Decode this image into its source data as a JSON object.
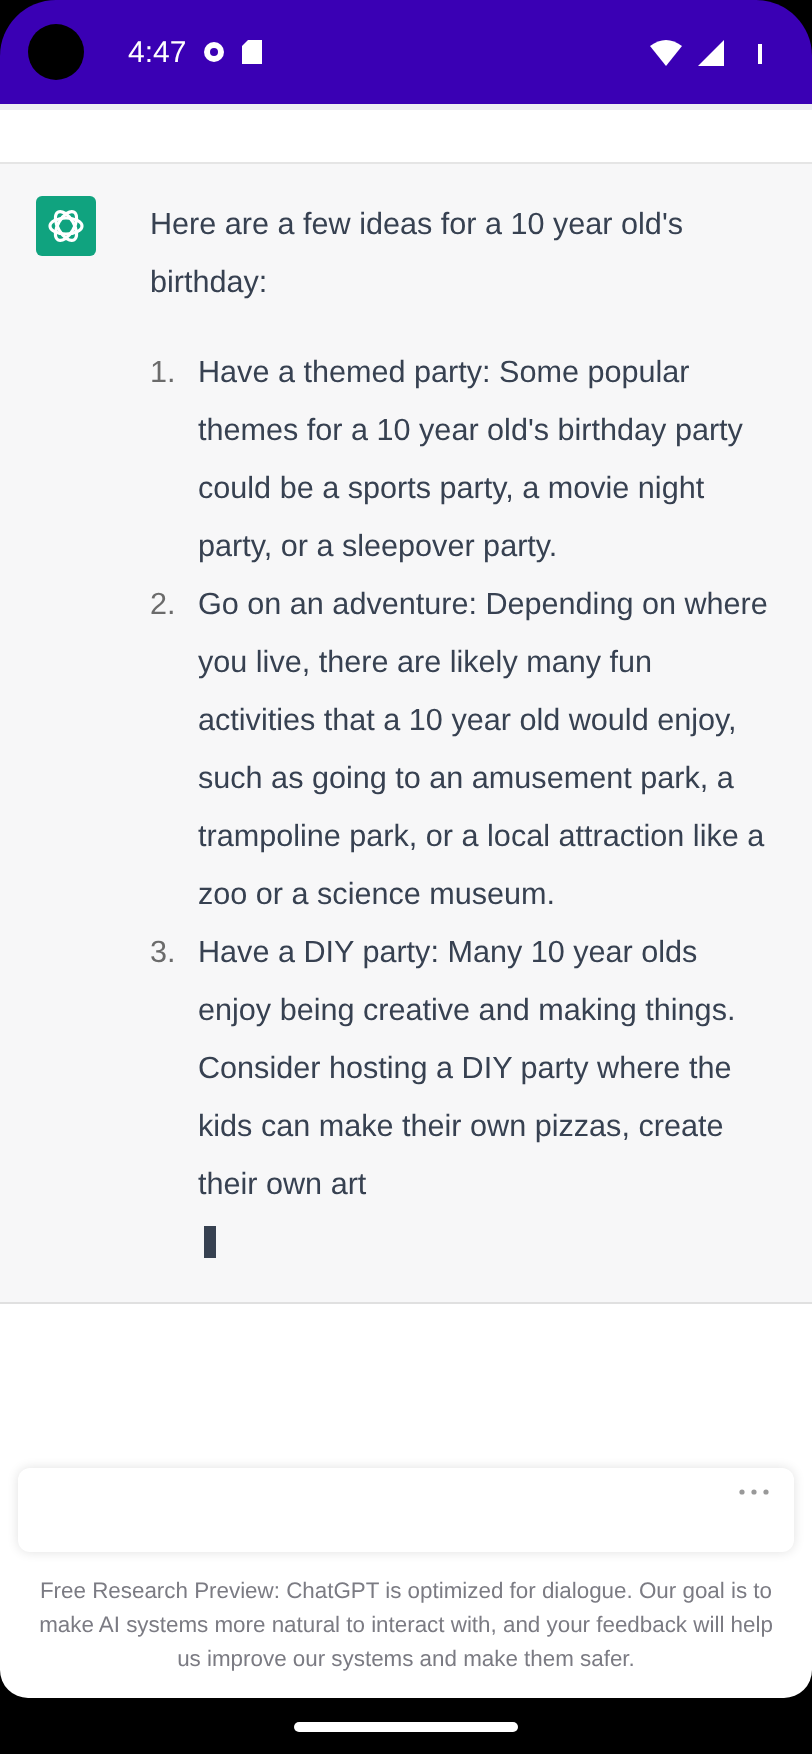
{
  "status_bar": {
    "time": "4:47"
  },
  "message": {
    "intro": "Here are a few ideas for a 10 year old's birthday:",
    "items": [
      {
        "number": "1.",
        "text": "Have a themed party: Some popular themes for a 10 year old's birthday party could be a sports party, a movie night party, or a sleepover party."
      },
      {
        "number": "2.",
        "text": "Go on an adventure: Depending on where you live, there are likely many fun activities that a 10 year old would enjoy, such as going to an amusement park, a trampoline park, or a local attraction like a zoo or a science museum."
      },
      {
        "number": "3.",
        "text": "Have a DIY party: Many 10 year olds enjoy being creative and making things. Consider hosting a DIY party where the kids can make their own pizzas, create their own art"
      }
    ],
    "streaming": true
  },
  "footer": {
    "disclaimer": "Free Research Preview: ChatGPT is optimized for dialogue. Our goal is to make AI systems more natural to interact with, and your feedback will help us improve our systems and make them safer."
  }
}
